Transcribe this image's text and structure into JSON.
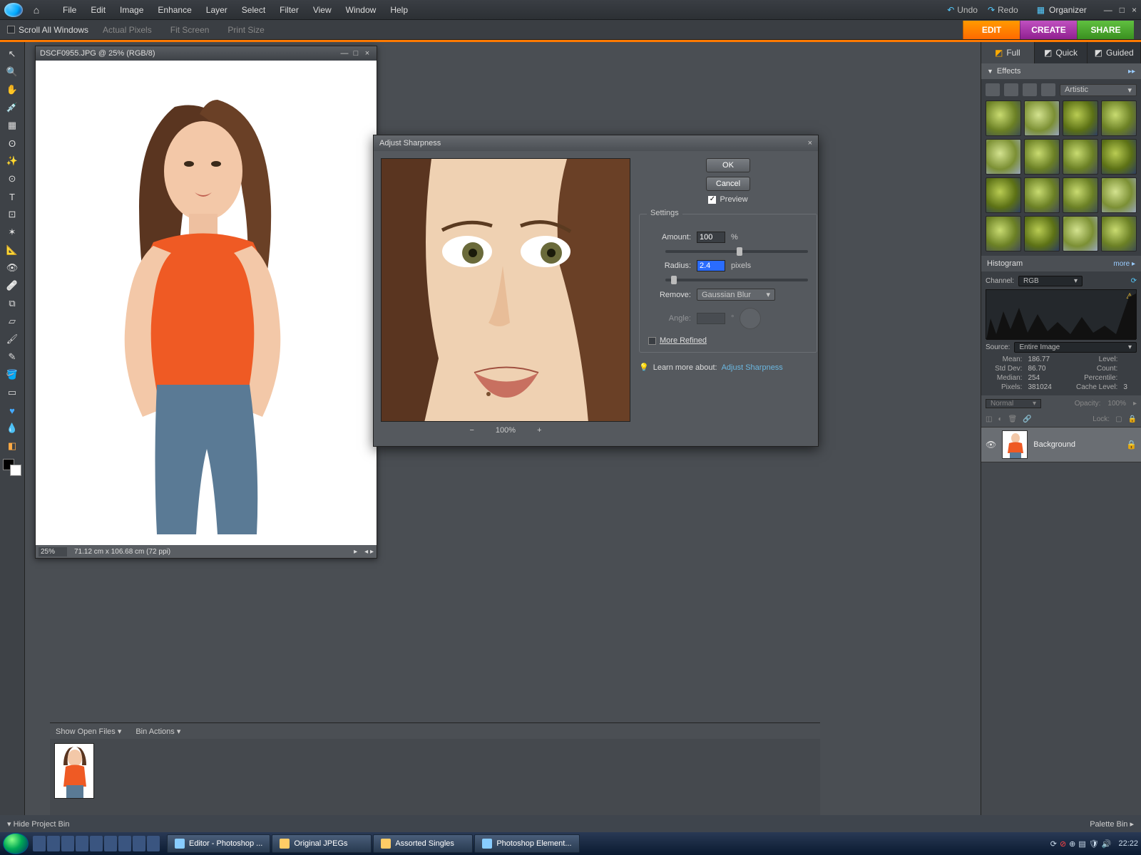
{
  "menubar": {
    "items": [
      "File",
      "Edit",
      "Image",
      "Enhance",
      "Layer",
      "Select",
      "Filter",
      "View",
      "Window",
      "Help"
    ],
    "undo": "Undo",
    "redo": "Redo",
    "organizer": "Organizer"
  },
  "optionbar": {
    "scroll_all": "Scroll All Windows",
    "actual_pixels": "Actual Pixels",
    "fit_screen": "Fit Screen",
    "print_size": "Print Size"
  },
  "actions": {
    "edit": "EDIT",
    "create": "CREATE",
    "share": "SHARE"
  },
  "edit_modes": {
    "full": "Full",
    "quick": "Quick",
    "guided": "Guided"
  },
  "document": {
    "title": "DSCF0955.JPG @ 25% (RGB/8)",
    "zoom": "25%",
    "dims": "71.12 cm x 106.68 cm (72 ppi)"
  },
  "dialog": {
    "title": "Adjust Sharpness",
    "ok": "OK",
    "cancel": "Cancel",
    "preview": "Preview",
    "settings_legend": "Settings",
    "amount_label": "Amount:",
    "amount_value": "100",
    "amount_unit": "%",
    "radius_label": "Radius:",
    "radius_value": "2.4",
    "radius_unit": "pixels",
    "remove_label": "Remove:",
    "remove_value": "Gaussian Blur",
    "angle_label": "Angle:",
    "angle_unit": "°",
    "more_refined": "More Refined",
    "learn": "Learn more about:",
    "learn_link": "Adjust Sharpness",
    "preview_zoom": "100%"
  },
  "effects": {
    "header": "Effects",
    "category": "Artistic"
  },
  "histogram": {
    "header": "Histogram",
    "more": "more ▸",
    "channel_label": "Channel:",
    "channel_value": "RGB",
    "source_label": "Source:",
    "source_value": "Entire Image",
    "stats": {
      "mean_k": "Mean:",
      "mean_v": "186.77",
      "std_k": "Std Dev:",
      "std_v": "86.70",
      "median_k": "Median:",
      "median_v": "254",
      "pixels_k": "Pixels:",
      "pixels_v": "381024",
      "level_k": "Level:",
      "count_k": "Count:",
      "percent_k": "Percentile:",
      "cache_k": "Cache Level:",
      "cache_v": "3"
    }
  },
  "layers": {
    "blend": "Normal",
    "opacity_label": "Opacity:",
    "opacity_value": "100%",
    "lock_label": "Lock:",
    "layer0": "Background"
  },
  "bin": {
    "show": "Show Open Files",
    "actions": "Bin Actions"
  },
  "footer": {
    "hide": "Hide Project Bin",
    "palette": "Palette Bin"
  },
  "taskbar": {
    "tasks": [
      "Editor - Photoshop ...",
      "Original JPEGs",
      "Assorted Singles",
      "Photoshop Element..."
    ],
    "clock": "22:22"
  }
}
